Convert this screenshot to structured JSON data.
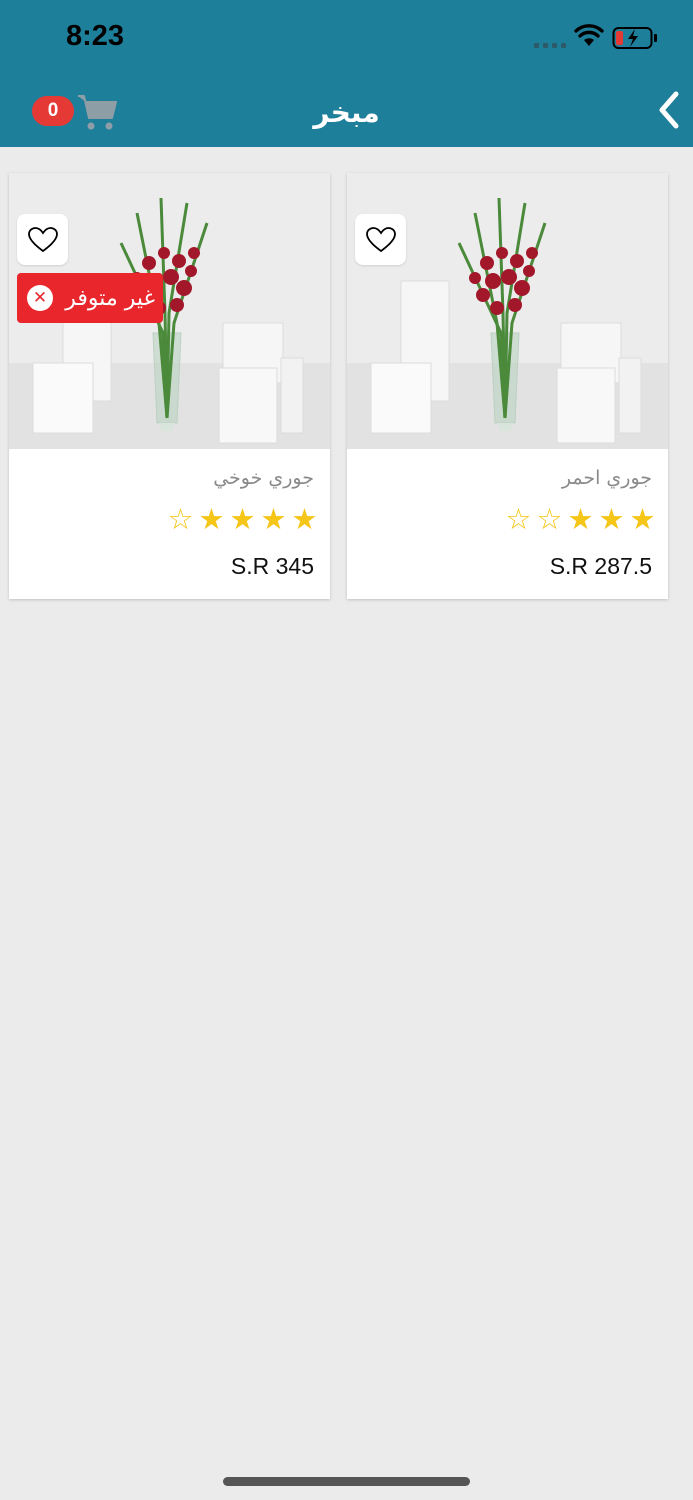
{
  "status_bar": {
    "time": "8:23"
  },
  "nav": {
    "title": "مبخر",
    "cart_count": "0"
  },
  "products": [
    {
      "name": "جوري احمر",
      "price": "S.R 287.5",
      "rating": 3,
      "max_rating": 5,
      "unavailable": false
    },
    {
      "name": "جوري خوخي",
      "price": "S.R 345",
      "rating": 4,
      "max_rating": 5,
      "unavailable": true,
      "unavailable_label": "غير متوفر"
    }
  ],
  "colors": {
    "header": "#1e7f9a",
    "badge": "#e53935",
    "star": "#f5c518",
    "unavailable": "#e8262b"
  }
}
